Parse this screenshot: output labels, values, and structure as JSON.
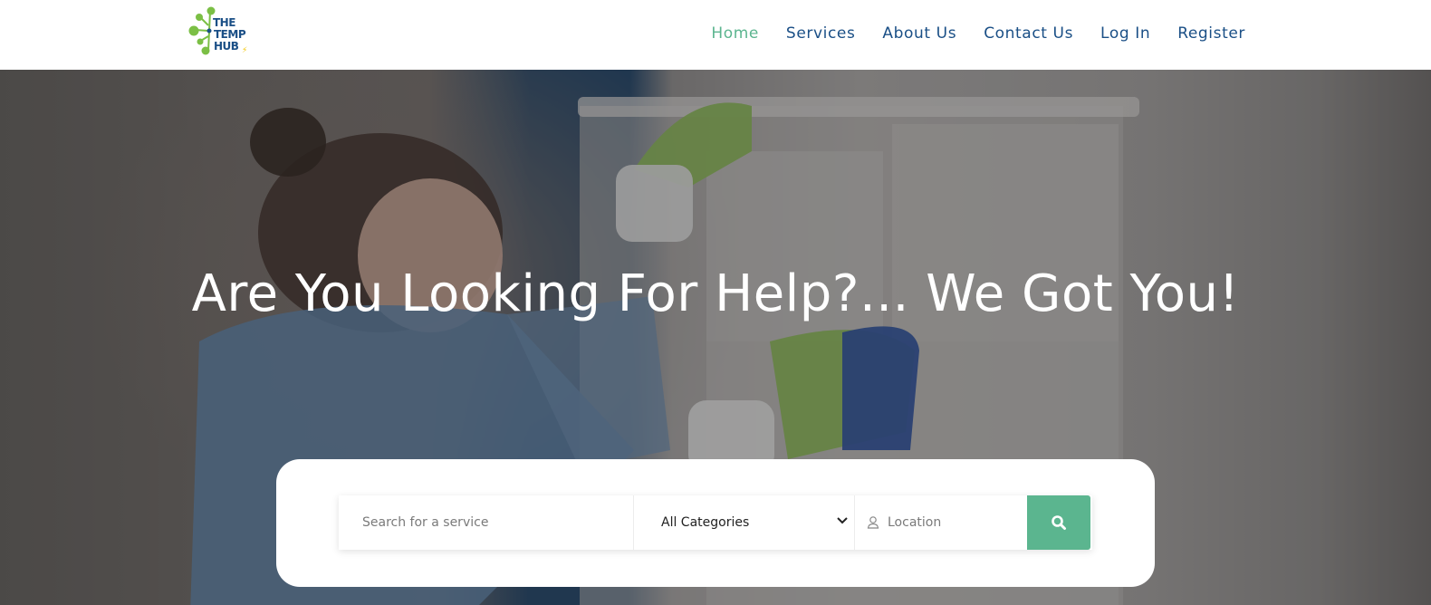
{
  "brand": {
    "logo_lines": [
      "THE",
      "TEMP",
      "HUB"
    ],
    "colors": {
      "primary": "#1a4f86",
      "accent": "#5bb58f",
      "logo_green": "#7bbf45"
    }
  },
  "nav": {
    "items": [
      {
        "label": "Home",
        "active": true
      },
      {
        "label": "Services",
        "active": false
      },
      {
        "label": "About Us",
        "active": false
      },
      {
        "label": "Contact Us",
        "active": false
      },
      {
        "label": "Log In",
        "active": false
      },
      {
        "label": "Register",
        "active": false
      }
    ]
  },
  "hero": {
    "title": "Are You Looking For Help?... We Got You!"
  },
  "search": {
    "service_placeholder": "Search for a service",
    "category_selected": "All Categories",
    "location_placeholder": "Location",
    "icons": {
      "category": "chevron-down-icon",
      "location": "user-pin-icon",
      "submit": "search-icon"
    }
  }
}
